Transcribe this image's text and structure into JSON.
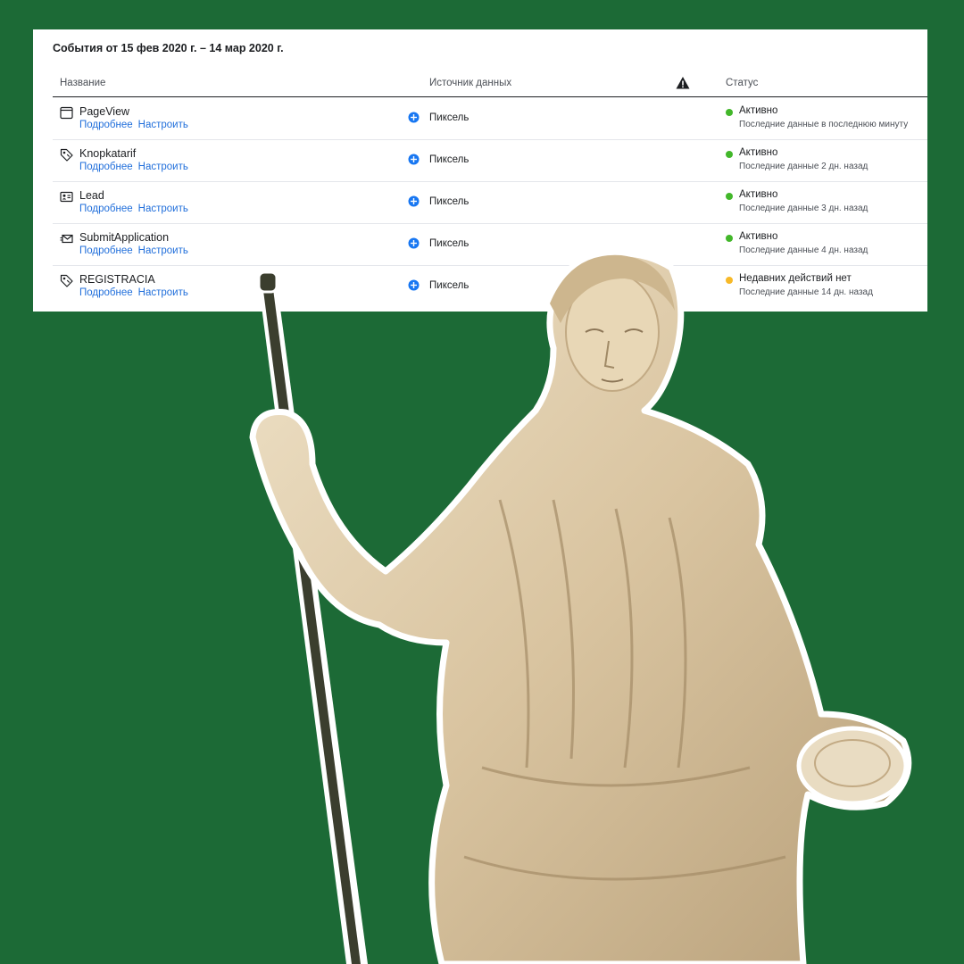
{
  "panel": {
    "title": "События от 15 фев 2020 г. – 14 мар 2020 г.",
    "columns": {
      "name": "Название",
      "source": "Источник данных",
      "status": "Статус",
      "warning_icon": "warning-triangle-icon"
    },
    "rows": [
      {
        "name": "PageView",
        "icon": "browser-window-icon",
        "link_details": "Подробнее",
        "link_configure": "Настроить",
        "source": "Пиксель",
        "status": "Активно",
        "status_color": "#42b72a",
        "last_data": "Последние данные в последнюю минуту"
      },
      {
        "name": "Knopkatarif",
        "icon": "tag-icon",
        "link_details": "Подробнее",
        "link_configure": "Настроить",
        "source": "Пиксель",
        "status": "Активно",
        "status_color": "#42b72a",
        "last_data": "Последние данные 2 дн. назад"
      },
      {
        "name": "Lead",
        "icon": "contact-card-icon",
        "link_details": "Подробнее",
        "link_configure": "Настроить",
        "source": "Пиксель",
        "status": "Активно",
        "status_color": "#42b72a",
        "last_data": "Последние данные 3 дн. назад"
      },
      {
        "name": "SubmitApplication",
        "icon": "envelope-send-icon",
        "link_details": "Подробнее",
        "link_configure": "Настроить",
        "source": "Пиксель",
        "status": "Активно",
        "status_color": "#42b72a",
        "last_data": "Последние данные 4 дн. назад"
      },
      {
        "name": "REGISTRACIA",
        "icon": "tag-icon",
        "link_details": "Подробнее",
        "link_configure": "Настроить",
        "source": "Пиксель",
        "status": "Недавних действий нет",
        "status_color": "#f7b928",
        "last_data": "Последние данные 14 дн. назад"
      }
    ]
  },
  "background": {
    "color": "#1c6a36"
  },
  "illustration": {
    "subject": "statue-illustration"
  }
}
